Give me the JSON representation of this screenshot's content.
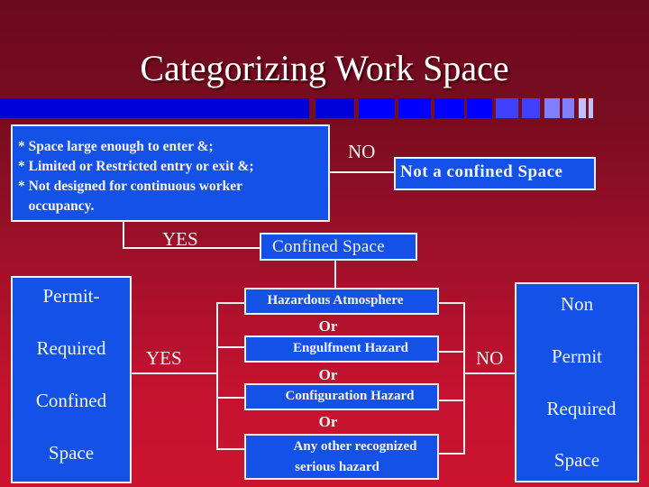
{
  "title": "Categorizing Work Space",
  "decor_bar": {
    "segments": [
      {
        "color": "#0000d8"
      },
      {
        "color": "#0000d8"
      },
      {
        "color": "#0000ff"
      },
      {
        "color": "#0000ff"
      },
      {
        "color": "#0000ff"
      },
      {
        "color": "#0000ff"
      },
      {
        "color": "#4040ff"
      },
      {
        "color": "#4040ff"
      },
      {
        "color": "#8080ff"
      },
      {
        "color": "#8080ff"
      },
      {
        "color": "#c0c0ff"
      },
      {
        "color": "#c0c0ff"
      }
    ]
  },
  "criteria_box": {
    "lines": [
      "* Space large enough to enter &;",
      "* Limited or Restricted entry or exit &;",
      "* Not designed for continuous worker",
      "   occupancy."
    ]
  },
  "labels": {
    "no_top": "NO",
    "yes_top": "YES",
    "yes_left": "YES",
    "no_right": "NO"
  },
  "not_confined_box": "Not a confined Space",
  "confined_box": "Confined Space",
  "permit_required_box": {
    "lines": [
      "Permit-",
      "Required",
      "Confined",
      "Space"
    ]
  },
  "non_permit_box": {
    "lines": [
      "Non",
      "Permit",
      "Required",
      "Space"
    ]
  },
  "hazards": {
    "items": [
      "Hazardous Atmosphere",
      "Engulfment Hazard",
      "Configuration Hazard",
      "Any other recognized serious hazard"
    ],
    "item4_lines": [
      "Any other recognized",
      "serious hazard"
    ],
    "separator": "Or"
  },
  "colors": {
    "box_fill": "#1451e6",
    "box_border": "#f2f2f2",
    "background_top": "#6a0a1f",
    "background_bottom": "#cc1431"
  }
}
